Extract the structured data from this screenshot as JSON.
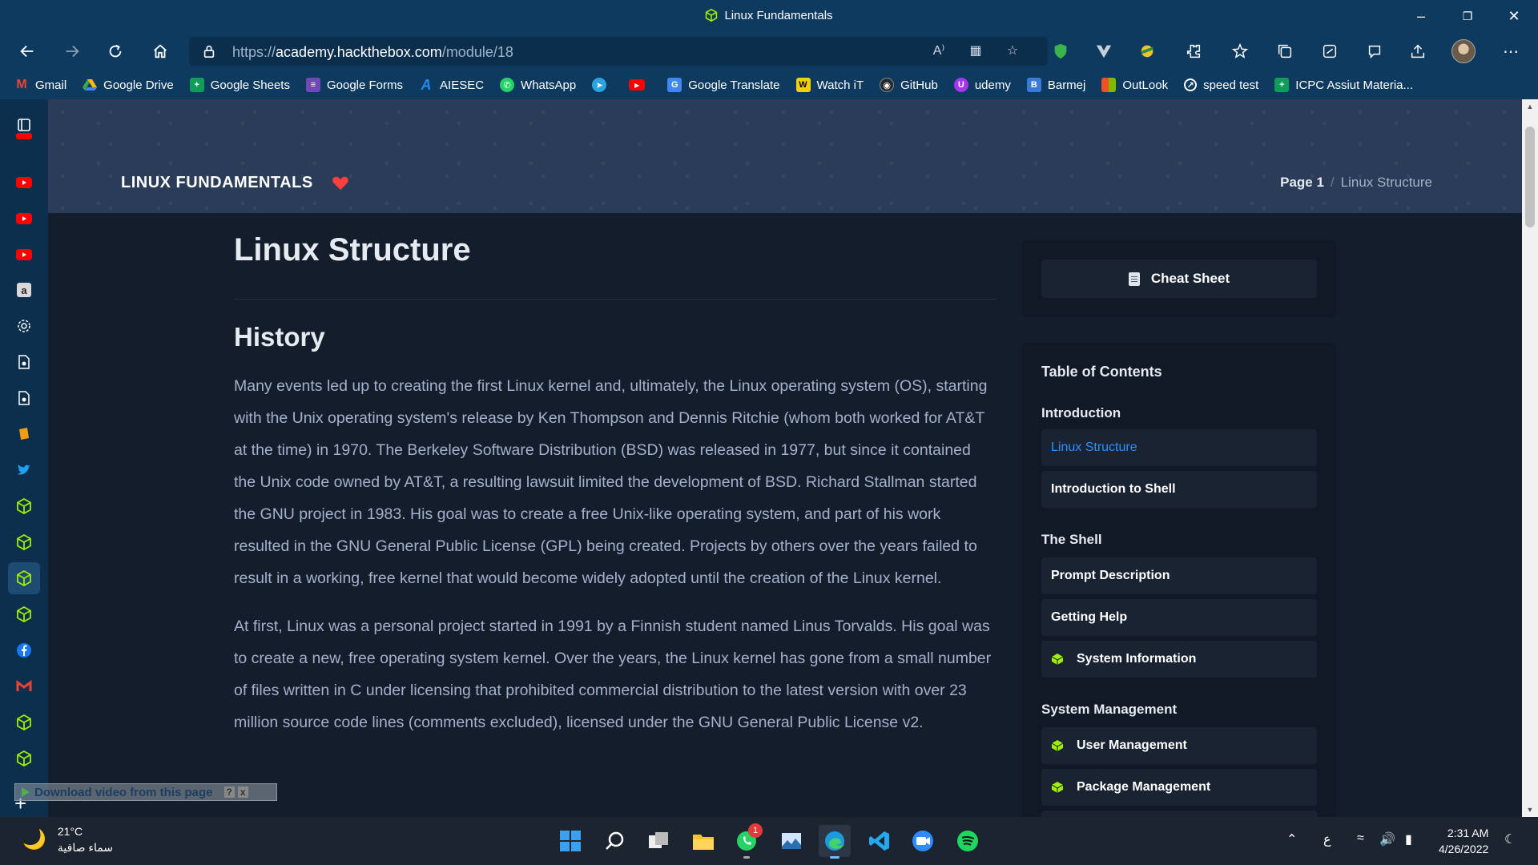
{
  "window": {
    "title": "Linux Fundamentals"
  },
  "address_bar": {
    "url_scheme": "https://",
    "url_host": "academy.hackthebox.com",
    "url_path": "/module/18"
  },
  "bookmarks": [
    {
      "label": "Gmail",
      "icon": "gmail-icon",
      "color": "#ea4335"
    },
    {
      "label": "Google Drive",
      "icon": "google-drive-icon",
      "color": "#34a853"
    },
    {
      "label": "Google Sheets",
      "icon": "google-sheets-icon",
      "color": "#0f9d58"
    },
    {
      "label": "Google Forms",
      "icon": "google-forms-icon",
      "color": "#7248b9"
    },
    {
      "label": "AIESEC",
      "icon": "aiesec-icon",
      "color": "#1f8ded"
    },
    {
      "label": "WhatsApp",
      "icon": "whatsapp-icon",
      "color": "#25d366"
    },
    {
      "label": "",
      "icon": "telegram-icon",
      "color": "#2aa3df"
    },
    {
      "label": "",
      "icon": "youtube-icon",
      "color": "#ff0000"
    },
    {
      "label": "Google Translate",
      "icon": "google-translate-icon",
      "color": "#4285f4"
    },
    {
      "label": "Watch iT",
      "icon": "watchit-icon",
      "color": "#f5d000"
    },
    {
      "label": "GitHub",
      "icon": "github-icon",
      "color": "#24292e"
    },
    {
      "label": "udemy",
      "icon": "udemy-icon",
      "color": "#a435f0"
    },
    {
      "label": "Barmej",
      "icon": "barmej-icon",
      "color": "#3a7bd5"
    },
    {
      "label": "OutLook",
      "icon": "outlook-icon",
      "color": "#f25022"
    },
    {
      "label": "speed test",
      "icon": "speedtest-icon",
      "color": "#222"
    },
    {
      "label": "ICPC Assiut Materia...",
      "icon": "icpc-icon",
      "color": "#0f9d58"
    }
  ],
  "page": {
    "module_title": "LINUX FUNDAMENTALS",
    "breadcrumb_page": "Page 1",
    "breadcrumb_separator": "/",
    "breadcrumb_current": "Linux Structure",
    "title": "Linux Structure",
    "section": "History",
    "paragraphs": [
      "Many events led up to creating the first Linux kernel and, ultimately, the Linux operating system (OS), starting with the Unix operating system's release by Ken Thompson and Dennis Ritchie (whom both worked for AT&T at the time) in 1970. The Berkeley Software Distribution (BSD) was released in 1977, but since it contained the Unix code owned by AT&T, a resulting lawsuit limited the development of BSD. Richard Stallman started the GNU project in 1983. His goal was to create a free Unix-like operating system, and part of his work resulted in the GNU General Public License (GPL) being created. Projects by others over the years failed to result in a working, free kernel that would become widely adopted until the creation of the Linux kernel.",
      "At first, Linux was a personal project started in 1991 by a Finnish student named Linus Torvalds. His goal was to create a new, free operating system kernel. Over the years, the Linux kernel has gone from a small number of files written in C under licensing that prohibited commercial distribution to the latest version with over 23 million source code lines (comments excluded), licensed under the GNU General Public License v2."
    ],
    "cheat_sheet": "Cheat Sheet"
  },
  "toc": {
    "title": "Table of Contents",
    "groups": [
      {
        "label": "Introduction",
        "items": [
          {
            "label": "Linux Structure",
            "active": true,
            "gem": false
          },
          {
            "label": "Introduction to Shell",
            "active": false,
            "gem": false
          }
        ]
      },
      {
        "label": "The Shell",
        "items": [
          {
            "label": "Prompt Description",
            "active": false,
            "gem": false
          },
          {
            "label": "Getting Help",
            "active": false,
            "gem": false
          },
          {
            "label": "System Information",
            "active": false,
            "gem": true
          }
        ]
      },
      {
        "label": "System Management",
        "items": [
          {
            "label": "User Management",
            "active": false,
            "gem": true
          },
          {
            "label": "Package Management",
            "active": false,
            "gem": true
          }
        ]
      }
    ]
  },
  "overlay": {
    "download_text": "Download video from this page",
    "help": "?",
    "close": "x"
  },
  "taskbar": {
    "temperature": "21°C",
    "weather_desc": "سماء صافية",
    "whatsapp_badge": "1",
    "tray_lang": "ع",
    "time": "2:31 AM",
    "date": "4/26/2022"
  },
  "colors": {
    "browser_chrome": "#0f3a5f",
    "page_bg": "#141d2b",
    "card_bg": "#111927",
    "accent_link": "#2e8fff",
    "htb_green": "#9fef00",
    "heart": "#ff3e3e"
  }
}
